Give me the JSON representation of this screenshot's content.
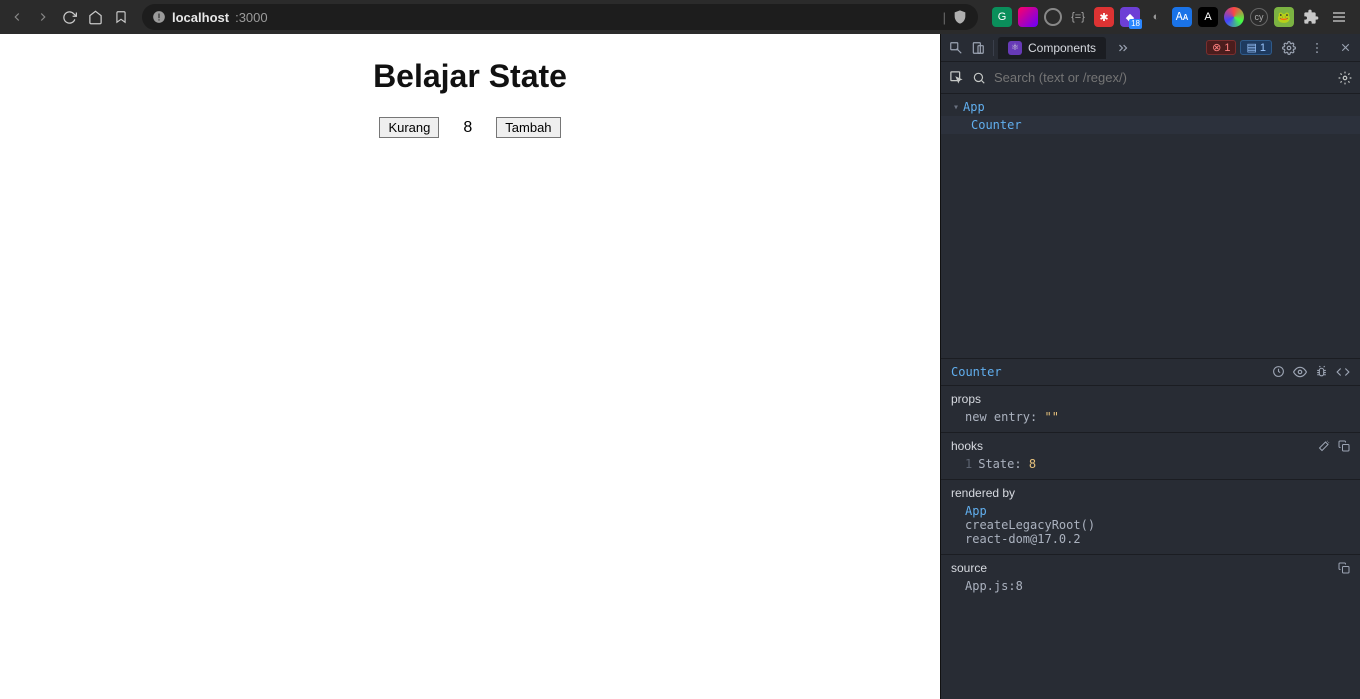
{
  "browser": {
    "url_host": "localhost",
    "url_port": ":3000",
    "extension_badge": "18"
  },
  "page": {
    "title": "Belajar State",
    "counter": {
      "decrement_label": "Kurang",
      "value": "8",
      "increment_label": "Tambah"
    }
  },
  "devtools": {
    "tab_label": "Components",
    "error_count": "1",
    "message_count": "1",
    "search_placeholder": "Search (text or /regex/)",
    "tree": {
      "root": "App",
      "child": "Counter"
    },
    "selected_component": "Counter",
    "props": {
      "section_title": "props",
      "new_entry_label": "new entry",
      "new_entry_value": "\"\""
    },
    "hooks": {
      "section_title": "hooks",
      "index": "1",
      "label": "State",
      "value": "8"
    },
    "rendered_by": {
      "section_title": "rendered by",
      "items": [
        "App",
        "createLegacyRoot()",
        "react-dom@17.0.2"
      ]
    },
    "source": {
      "section_title": "source",
      "value": "App.js:8"
    }
  }
}
